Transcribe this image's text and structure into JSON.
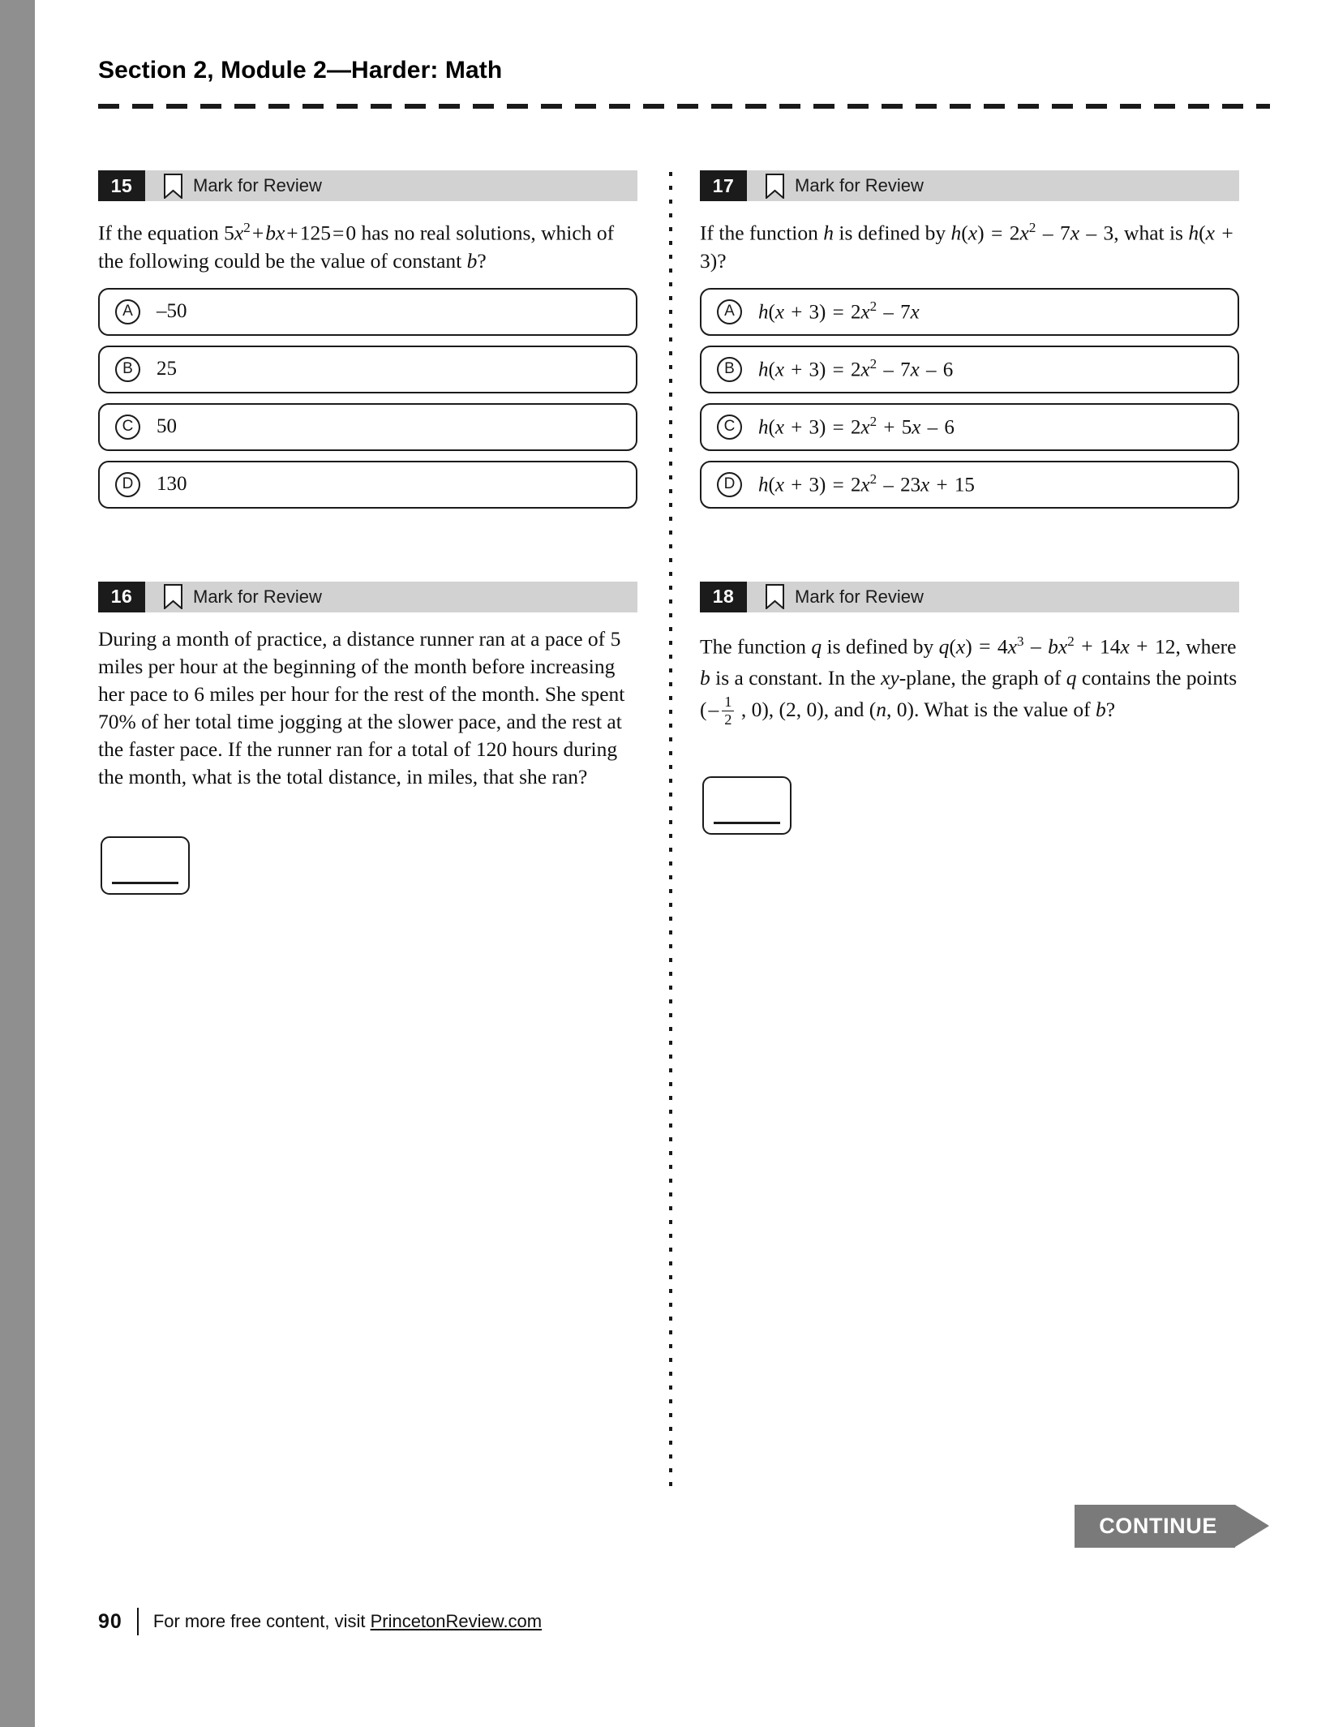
{
  "page": {
    "running_head": "Section 2, Module 2—Harder: Math",
    "folio": "90",
    "footer_prefix": "For more free content, visit ",
    "footer_link": "PrincetonReview.com",
    "continue_label": "CONTINUE",
    "colors": {
      "margin_bar": "#8f8f8f",
      "qbar_background": "#d2d2d2",
      "qnum_background": "#1b1b1b",
      "continue_background": "#7a7a7a",
      "ink": "#101010"
    }
  },
  "mark_for_review_label": "Mark for Review",
  "questions": [
    {
      "number": "15",
      "column": "left",
      "type": "multiple-choice",
      "stem_plain": "If the equation 5x² + bx + 125 = 0 has no real solutions, which of the following could be the value of constant b?",
      "choices": [
        {
          "letter": "A",
          "text": "–50"
        },
        {
          "letter": "B",
          "text": "25"
        },
        {
          "letter": "C",
          "text": "50"
        },
        {
          "letter": "D",
          "text": "130"
        }
      ]
    },
    {
      "number": "16",
      "column": "left",
      "type": "student-produced-response",
      "stem_plain": "During a month of practice, a distance runner ran at a pace of 5 miles per hour at the beginning of the month before increasing her pace to 6 miles per hour for the rest of the month. She spent 70% of her total time jogging at the slower pace, and the rest at the faster pace. If the runner ran for a total of 120 hours during the month, what is the total distance, in miles, that she ran?",
      "stem_values": {
        "slow_pace": "5",
        "fast_pace": "6",
        "percent_slow": "70%",
        "total_hours": "120"
      },
      "answer_value": ""
    },
    {
      "number": "17",
      "column": "right",
      "type": "multiple-choice",
      "stem_plain": "If the function h is defined by h(x) = 2x² – 7x – 3, what is h(x + 3)?",
      "choices": [
        {
          "letter": "A",
          "text": "h(x + 3) = 2x² – 7x"
        },
        {
          "letter": "B",
          "text": "h(x + 3) = 2x² – 7x – 6"
        },
        {
          "letter": "C",
          "text": "h(x + 3) = 2x² + 5x – 6"
        },
        {
          "letter": "D",
          "text": "h(x + 3) = 2x² – 23x + 15"
        }
      ]
    },
    {
      "number": "18",
      "column": "right",
      "type": "student-produced-response",
      "stem_plain": "The function q is defined by q(x) = 4x³ – bx² + 14x + 12, where b is a constant. In the xy-plane, the graph of q contains the points (–1/2, 0), (2, 0), and (n, 0). What is the value of b?",
      "stem_values": {
        "point_1": "(–1/2, 0)",
        "point_2": "(2, 0)",
        "point_3": "(n, 0)"
      },
      "answer_value": ""
    }
  ]
}
